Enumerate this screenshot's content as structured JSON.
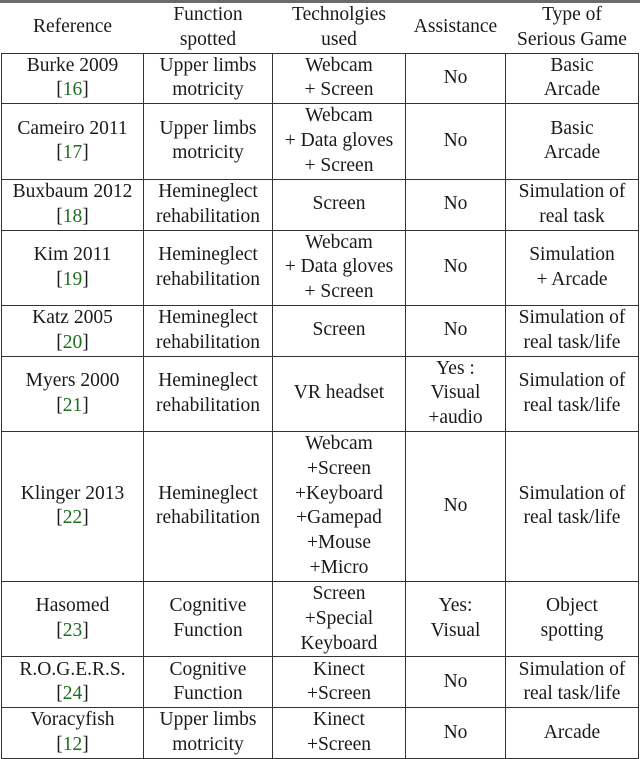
{
  "table": {
    "headers": [
      [
        "Reference"
      ],
      [
        "Function",
        "spotted"
      ],
      [
        "Technolgies",
        "used"
      ],
      [
        "Assistance"
      ],
      [
        "Type of",
        "Serious Game"
      ]
    ],
    "rows": [
      {
        "reference": "Burke 2009",
        "cite": "16",
        "function": [
          "Upper limbs",
          "motricity"
        ],
        "tech": [
          "Webcam",
          "+ Screen"
        ],
        "assistance": [
          "No"
        ],
        "game": [
          "Basic",
          "Arcade"
        ]
      },
      {
        "reference": "Cameiro 2011",
        "cite": "17",
        "function": [
          "Upper limbs",
          "motricity"
        ],
        "tech": [
          "Webcam",
          "+ Data gloves",
          "+ Screen"
        ],
        "assistance": [
          "No"
        ],
        "game": [
          "Basic",
          "Arcade"
        ]
      },
      {
        "reference": "Buxbaum 2012",
        "cite": "18",
        "function": [
          "Hemineglect",
          "rehabilitation"
        ],
        "tech": [
          "Screen"
        ],
        "assistance": [
          "No"
        ],
        "game": [
          "Simulation of",
          "real task"
        ]
      },
      {
        "reference": "Kim 2011",
        "cite": "19",
        "function": [
          "Hemineglect",
          "rehabilitation"
        ],
        "tech": [
          "Webcam",
          "+ Data gloves",
          "+ Screen"
        ],
        "assistance": [
          "No"
        ],
        "game": [
          "Simulation",
          "+ Arcade"
        ]
      },
      {
        "reference": "Katz 2005",
        "cite": "20",
        "function": [
          "Hemineglect",
          "rehabilitation"
        ],
        "tech": [
          "Screen"
        ],
        "assistance": [
          "No"
        ],
        "game": [
          "Simulation of",
          "real task/life"
        ]
      },
      {
        "reference": "Myers 2000",
        "cite": "21",
        "function": [
          "Hemineglect",
          "rehabilitation"
        ],
        "tech": [
          "VR headset"
        ],
        "assistance": [
          "Yes :",
          "Visual",
          "+audio"
        ],
        "game": [
          "Simulation of",
          "real task/life"
        ]
      },
      {
        "reference": "Klinger 2013",
        "cite": "22",
        "function": [
          "Hemineglect",
          "rehabilitation"
        ],
        "tech": [
          "Webcam",
          "+Screen",
          "+Keyboard",
          "+Gamepad",
          "+Mouse",
          "+Micro"
        ],
        "assistance": [
          "No"
        ],
        "game": [
          "Simulation of",
          "real task/life"
        ]
      },
      {
        "reference": "Hasomed",
        "cite": "23",
        "function": [
          "Cognitive",
          "Function"
        ],
        "tech": [
          "Screen",
          "+Special",
          "Keyboard"
        ],
        "assistance": [
          "Yes:",
          "Visual"
        ],
        "game": [
          "Object",
          "spotting"
        ]
      },
      {
        "reference": "R.O.G.E.R.S.",
        "cite": "24",
        "function": [
          "Cognitive",
          "Function"
        ],
        "tech": [
          "Kinect",
          "+Screen"
        ],
        "assistance": [
          "No"
        ],
        "game": [
          "Simulation of",
          "real task/life"
        ]
      },
      {
        "reference": "Voracyfish",
        "cite": "12",
        "function": [
          "Upper limbs",
          "motricity"
        ],
        "tech": [
          "Kinect",
          "+Screen"
        ],
        "assistance": [
          "No"
        ],
        "game": [
          "Arcade"
        ]
      }
    ]
  },
  "colors": {
    "citation": "#1f6e1f",
    "border": "#333333",
    "top_band": "#6b6b6b"
  }
}
